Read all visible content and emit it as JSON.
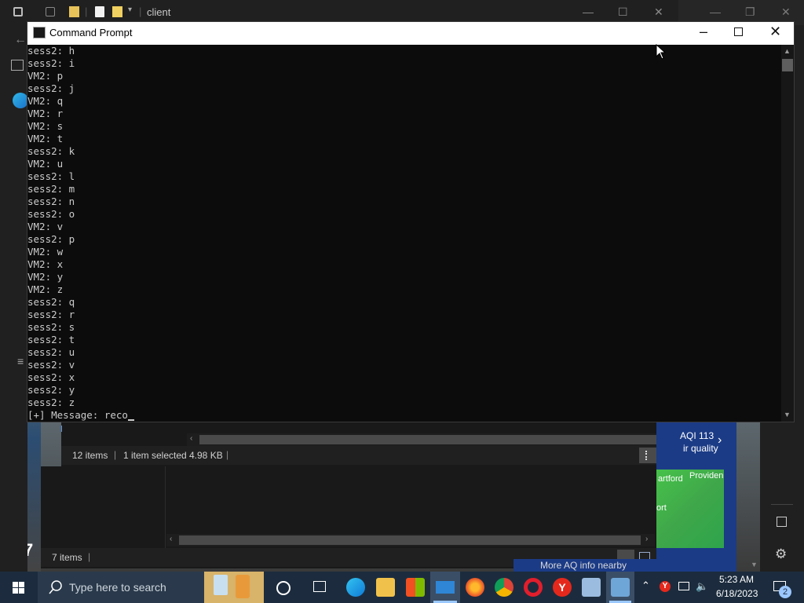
{
  "explorer": {
    "title": "client",
    "status1": {
      "items": "12 items",
      "selected": "1 item selected",
      "size": "4.98 KB"
    },
    "status2": {
      "items": "7 items"
    }
  },
  "weather": {
    "aqi": "AQI 113",
    "quality": "ir quality",
    "city1": "artford",
    "city2": "Providen",
    "city3": "ort",
    "more": "More AQ info nearby"
  },
  "desktop": {
    "date_fragment": "7"
  },
  "cmd": {
    "title": "Command Prompt",
    "lines": [
      "sess2: h",
      "sess2: i",
      "VM2: p",
      "sess2: j",
      "VM2: q",
      "VM2: r",
      "VM2: s",
      "VM2: t",
      "sess2: k",
      "VM2: u",
      "sess2: l",
      "sess2: m",
      "sess2: n",
      "sess2: o",
      "VM2: v",
      "sess2: p",
      "VM2: w",
      "VM2: x",
      "VM2: y",
      "VM2: z",
      "sess2: q",
      "sess2: r",
      "sess2: s",
      "sess2: t",
      "sess2: u",
      "sess2: v",
      "sess2: x",
      "sess2: y",
      "sess2: z"
    ],
    "prompt": "[+] Message: reco"
  },
  "taskbar": {
    "search_placeholder": "Type here to search",
    "time": "5:23 AM",
    "date": "6/18/2023",
    "notification_count": "2",
    "icons": [
      "task-view-icon",
      "edge-icon",
      "file-explorer-icon",
      "store-icon",
      "mail-icon",
      "firefox-icon",
      "chrome-icon",
      "opera-icon",
      "yandex-icon",
      "remote-desktop-icon",
      "network-app-icon"
    ]
  },
  "colors": {
    "taskbar": "#1c2c3e",
    "cmd_bg": "#0c0c0c",
    "cmd_text": "#cccccc",
    "weather": "#1b3b86"
  }
}
